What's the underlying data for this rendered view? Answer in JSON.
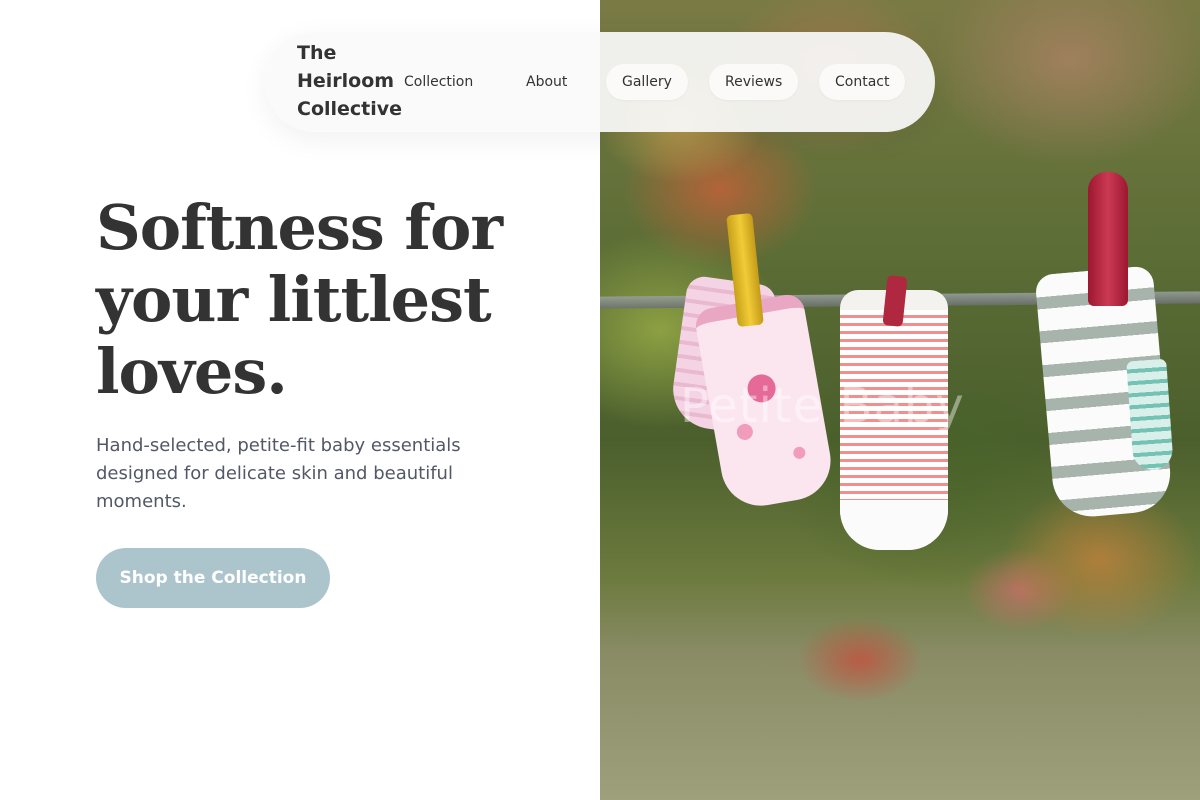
{
  "brand": {
    "name": "The Heirloom Collective"
  },
  "nav": {
    "items": [
      {
        "label": "Collection"
      },
      {
        "label": "About"
      },
      {
        "label": "Gallery"
      },
      {
        "label": "Reviews"
      },
      {
        "label": "Contact"
      }
    ]
  },
  "hero": {
    "headline": "Softness for your littlest loves.",
    "subtext": "Hand-selected, petite-fit baby essentials designed for delicate skin and beautiful moments.",
    "cta_label": "Shop the Collection",
    "image_watermark": "Petite Baby"
  },
  "colors": {
    "background": "#ffffff",
    "text": "#333333",
    "muted_text": "#525866",
    "cta": "#acc4cc",
    "cta_text": "#ffffff"
  }
}
